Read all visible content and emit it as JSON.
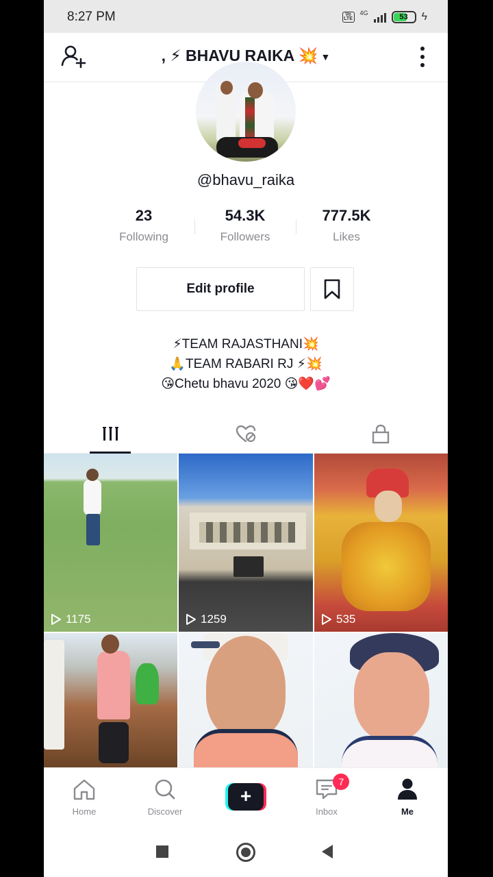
{
  "status_bar": {
    "time": "8:27 PM",
    "network": "4G",
    "volte": "Vo LTE",
    "battery": "53"
  },
  "header": {
    "title": ", ⚡ BHAVU RAIKA 💥"
  },
  "profile": {
    "username": "@bhavu_raika",
    "stats": [
      {
        "value": "23",
        "label": "Following"
      },
      {
        "value": "54.3K",
        "label": "Followers"
      },
      {
        "value": "777.5K",
        "label": "Likes"
      }
    ],
    "edit_label": "Edit profile",
    "bio": [
      "⚡TEAM RAJASTHANI💥",
      "🙏TEAM  RABARI  RJ ⚡💥",
      "😘Chetu bhavu 2020 😘❤️💕"
    ]
  },
  "tabs": [
    "videos-grid-icon",
    "liked-heart-icon",
    "private-lock-icon"
  ],
  "videos": [
    {
      "views": "1175"
    },
    {
      "views": "1259"
    },
    {
      "views": "535"
    },
    {
      "views": ""
    },
    {
      "views": ""
    },
    {
      "views": ""
    }
  ],
  "bottom_nav": {
    "home": "Home",
    "discover": "Discover",
    "inbox": "Inbox",
    "inbox_badge": "7",
    "me": "Me"
  },
  "colors": {
    "accent_red": "#fe2c55",
    "accent_cyan": "#25f4ee",
    "text": "#161823",
    "muted": "#8a8b91"
  }
}
